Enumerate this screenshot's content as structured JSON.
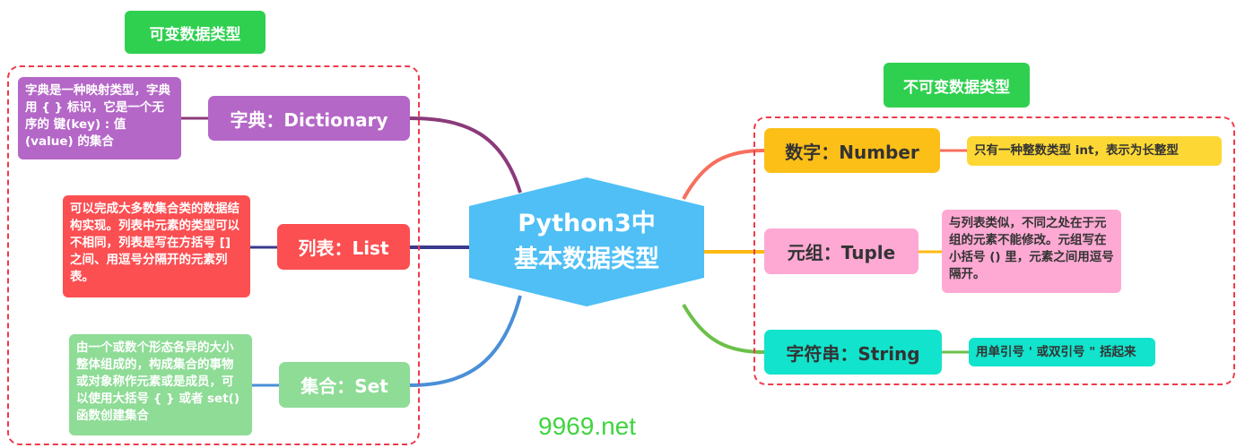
{
  "center": {
    "line1": "Python3中",
    "line2": "基本数据类型",
    "color": "#4fbff5"
  },
  "mutable": {
    "label": "可变数据类型",
    "items": [
      {
        "name": "字典：Dictionary",
        "desc": "字典是一种映射类型，字典用 { } 标识，它是一个无序的 键(key) : 值(value) 的集合",
        "color": "#b467c7",
        "line": "#8b3a7a"
      },
      {
        "name": "列表：List",
        "desc": " 可以完成大多数集合类的数据结构实现。列表中元素的类型可以不相同，列表是写在方括号 [] 之间、用逗号分隔开的元素列表。",
        "color": "#fb4f52",
        "line": "#3a3a8f"
      },
      {
        "name": "集合：Set",
        "desc": "由一个或数个形态各异的大小整体组成的，构成集合的事物或对象称作元素或是成员，可以使用大括号 { } 或者 set() 函数创建集合",
        "color": "#8edc96",
        "line": "#4a8fd8"
      }
    ]
  },
  "immutable": {
    "label": "不可变数据类型",
    "items": [
      {
        "name": "数字：Number",
        "desc": "只有一种整数类型 int，表示为长整型",
        "color": "#fcbf17",
        "desc_color": "#fdd835",
        "line": "#f76f5e"
      },
      {
        "name": "元组：Tuple",
        "desc": "与列表类似，不同之处在于元组的元素不能修改。元组写在小括号 () 里，元素之间用逗号隔开。",
        "color": "#fea9d3",
        "desc_color": "#fea9d3",
        "line": "#fdb913"
      },
      {
        "name": "字符串：String",
        "desc": "用单引号 ' 或双引号 \" 括起来",
        "color": "#12e3cc",
        "desc_color": "#12e3cc",
        "line": "#6cc04a"
      }
    ]
  },
  "watermark": "9969.net"
}
